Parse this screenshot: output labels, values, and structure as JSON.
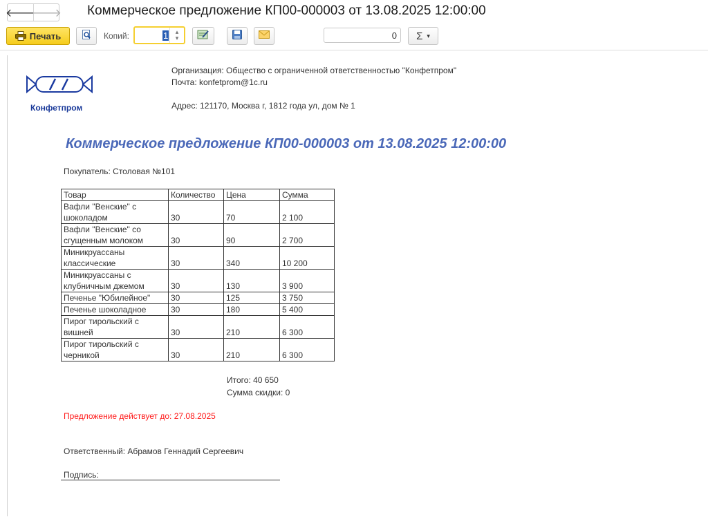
{
  "window": {
    "title": "Коммерческое предложение КП00-000003 от 13.08.2025 12:00:00",
    "back_glyph": "🡐",
    "forward_glyph": "🡒"
  },
  "toolbar": {
    "print_label": "Печать",
    "copies_label": "Копий:",
    "copies_value": "1",
    "sum_value": "0",
    "sigma_glyph": "Σ",
    "icons": [
      "printer-icon",
      "preview-icon",
      "spinner-icon",
      "edit-icon",
      "save-icon",
      "mail-icon",
      "sigma-icon"
    ]
  },
  "document": {
    "logo_name": "Конфетпром",
    "organization": "Организация: Общество с ограниченной ответственностью \"Конфетпром\"",
    "email": "Почта: konfetprom@1c.ru",
    "address": "Адрес: 121170, Москва г, 1812 года ул, дом № 1",
    "title": "Коммерческое предложение КП00-000003 от 13.08.2025 12:00:00",
    "buyer": "Покупатель: Столовая №101",
    "table": {
      "headers": [
        "Товар",
        "Количество",
        "Цена",
        "Сумма"
      ],
      "rows": [
        {
          "name": [
            "Вафли \"Венские\" с",
            "шоколадом"
          ],
          "qty": "30",
          "price": "70",
          "sum": "2 100"
        },
        {
          "name": [
            "Вафли \"Венские\" со",
            "сгущенным молоком"
          ],
          "qty": "30",
          "price": "90",
          "sum": "2 700"
        },
        {
          "name": [
            "Миникруассаны",
            "классические"
          ],
          "qty": "30",
          "price": "340",
          "sum": "10 200"
        },
        {
          "name": [
            "Миникруассаны с",
            "клубничным джемом"
          ],
          "qty": "30",
          "price": "130",
          "sum": "3 900"
        },
        {
          "name": [
            "Печенье \"Юбилейное\""
          ],
          "qty": "30",
          "price": "125",
          "sum": "3 750"
        },
        {
          "name": [
            "Печенье шоколадное"
          ],
          "qty": "30",
          "price": "180",
          "sum": "5 400"
        },
        {
          "name": [
            "Пирог тирольский с",
            "вишней"
          ],
          "qty": "30",
          "price": "210",
          "sum": "6 300"
        },
        {
          "name": [
            "Пирог тирольский с",
            "черникой"
          ],
          "qty": "30",
          "price": "210",
          "sum": "6 300"
        }
      ]
    },
    "total": "Итого: 40 650",
    "discount": "Сумма скидки: 0",
    "valid_until": "Предложение действует до: 27.08.2025",
    "responsible": "Ответственный: Абрамов Геннадий Сергеевич",
    "signature": "Подпись:",
    "colors": {
      "title": "#4a68b8",
      "valid": "#ff1a1a",
      "logo": "#1a3a9a",
      "print_button": "#f5cc1c"
    }
  }
}
